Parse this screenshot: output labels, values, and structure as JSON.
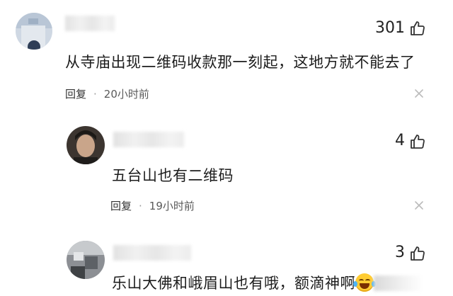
{
  "comments": [
    {
      "likes": "301",
      "text": "从寺庙出现二维码收款那一刻起，这地方就不能去了",
      "reply_label": "回复",
      "separator": "·",
      "time": "20小时前"
    },
    {
      "likes": "4",
      "text": "五台山也有二维码",
      "reply_label": "回复",
      "separator": "·",
      "time": "19小时前"
    },
    {
      "likes": "3",
      "text": "乐山大佛和峨眉山也有哦，额滴神啊"
    }
  ],
  "colors": {
    "icon_stroke": "#333333",
    "meta_text": "#5a5a5a",
    "body_text": "#1c1c1c"
  }
}
